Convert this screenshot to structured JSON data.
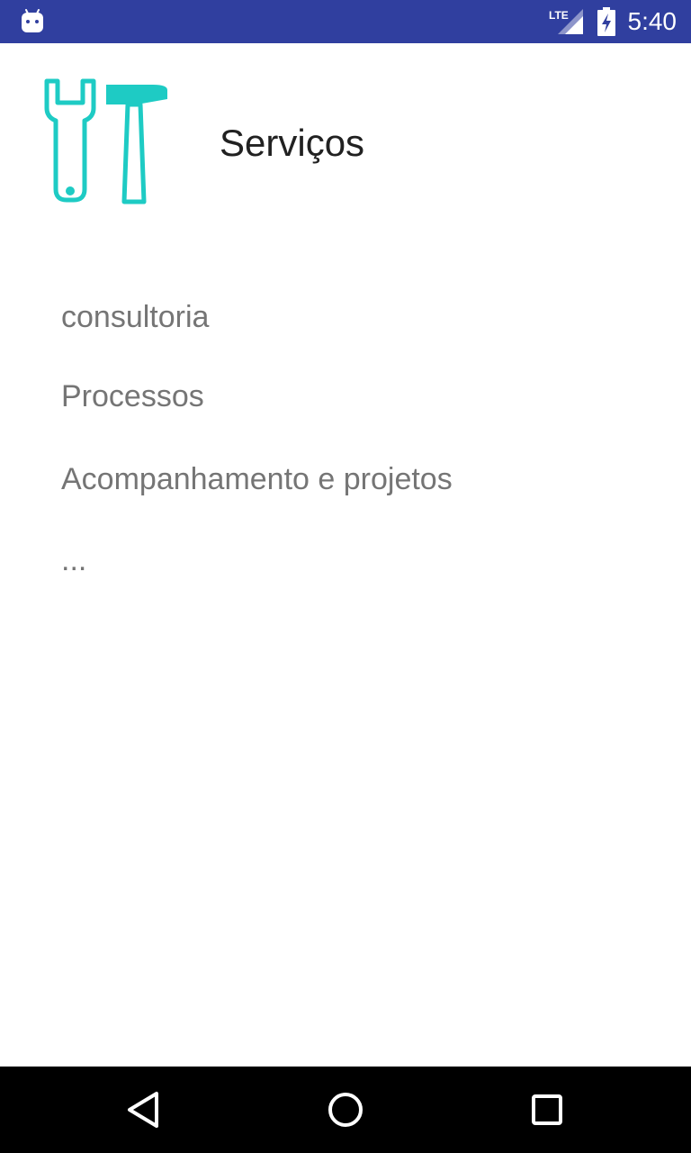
{
  "status_bar": {
    "time": "5:40",
    "network_label": "LTE",
    "icons": [
      "android-icon",
      "lte-signal-icon",
      "battery-charging-icon"
    ]
  },
  "header": {
    "title": "Serviços",
    "icon": "tools-icon",
    "icon_color": "#1ecbc4"
  },
  "services": [
    "consultoria",
    "Processos",
    "Acompanhamento e projetos",
    "..."
  ],
  "nav_bar": {
    "icons": [
      "back-icon",
      "home-icon",
      "recents-icon"
    ]
  },
  "colors": {
    "status_bar": "#303f9f",
    "title_text": "#212121",
    "list_text": "#757575",
    "nav_bar": "#000000"
  }
}
